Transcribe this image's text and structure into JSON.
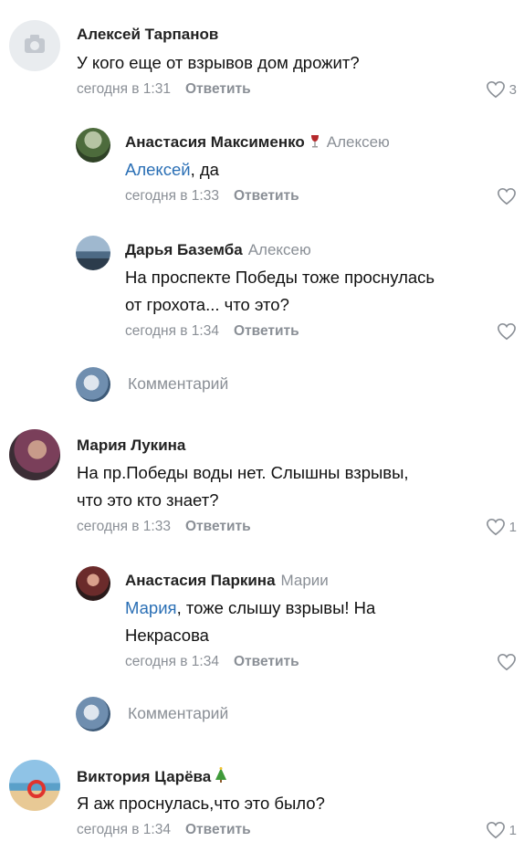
{
  "comments": [
    {
      "author": "Алексей Тарпанов",
      "text_lines": [
        "У кого еще от взрывов дом дрожит?"
      ],
      "time": "сегодня в 1:31",
      "reply_label": "Ответить",
      "likes": "3",
      "avatar": "camera-placeholder",
      "replies": [
        {
          "author": "Анастасия Максименко",
          "emoji": "wine-glass",
          "reply_to": "Алексею",
          "mention": "Алексей",
          "text_rest": ", да",
          "time": "сегодня в 1:33",
          "reply_label": "Ответить"
        },
        {
          "author": "Дарья Баземба",
          "reply_to": "Алексею",
          "text_lines": [
            "На проспекте Победы тоже проснулась",
            "от грохота... что это?"
          ],
          "time": "сегодня в 1:34",
          "reply_label": "Ответить"
        }
      ],
      "compose_placeholder": "Комментарий"
    },
    {
      "author": "Мария Лукина",
      "text_lines": [
        "На пр.Победы воды нет.  Слышны взрывы,",
        "что это кто знает?"
      ],
      "time": "сегодня в 1:33",
      "reply_label": "Ответить",
      "likes": "1",
      "replies": [
        {
          "author": "Анастасия Паркина",
          "reply_to": "Марии",
          "mention": "Мария",
          "text_rest": ", тоже  слышу взрывы! На",
          "text_line2": "Некрасова",
          "time": "сегодня в 1:34",
          "reply_label": "Ответить"
        }
      ],
      "compose_placeholder": "Комментарий"
    },
    {
      "author": "Виктория Царёва",
      "emoji": "christmas-tree",
      "text_lines": [
        "Я аж проснулась,что это было?"
      ],
      "time": "сегодня в 1:34",
      "reply_label": "Ответить",
      "likes": "1"
    }
  ],
  "colors": {
    "mention": "#2a6fb5",
    "meta": "#8a8f96"
  }
}
